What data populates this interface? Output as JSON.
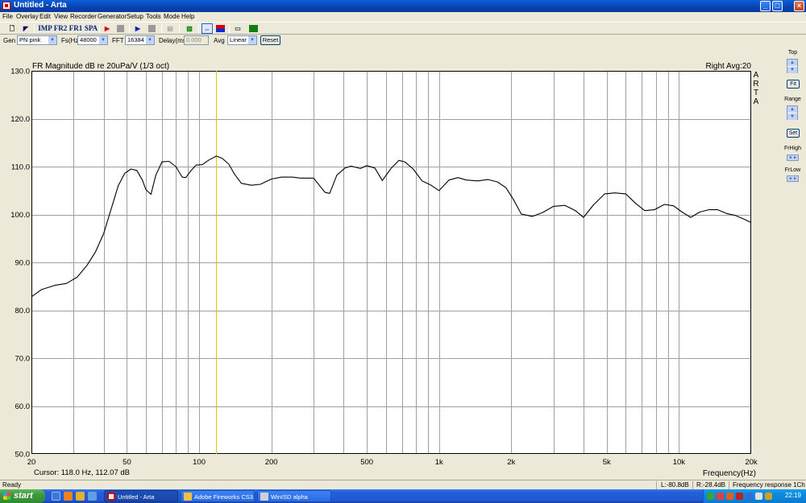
{
  "window": {
    "title": "Untitled - Arta"
  },
  "menu": [
    "File",
    "Overlay",
    "Edit",
    "View",
    "Recorder",
    "Generator",
    "Setup",
    "Tools",
    "Mode",
    "Help"
  ],
  "toolbar": {
    "imp": "IMP",
    "fr2": "FR2",
    "fr1": "FR1",
    "spa": "SPA"
  },
  "controls": {
    "gen_label": "Gen",
    "gen_value": "PN pink",
    "fs_label": "Fs(Hz)",
    "fs_value": "48000",
    "fft_label": "FFT",
    "fft_value": "16384",
    "delay_label": "Delay(ms)",
    "delay_value": "0.000",
    "avg_label": "Avg",
    "avg_value": "Linear",
    "reset_label": "Reset"
  },
  "right_panel": {
    "top_label": "Top",
    "fit_label": "Fit",
    "range_label": "Range",
    "set_label": "Set",
    "frhigh_label": "FrHigh",
    "frlow_label": "FrLow"
  },
  "status": {
    "left": "Ready",
    "l_value": "L:-80.8dB",
    "r_value": "R:-28.4dB",
    "mode": "Frequency response 1Ch"
  },
  "taskbar": {
    "start": "start",
    "tasks": [
      "Untitled - Arta",
      "Adobe Fireworks CS3...",
      "WinISD alpha"
    ],
    "clock": "22:19"
  },
  "colors": {
    "cursor": "#d8c800",
    "curve": "#000000",
    "grid": "#a0a0a0",
    "plot_bg": "#ffffff"
  },
  "chart_data": {
    "type": "line",
    "title": "FR Magnitude dB re 20uPa/V (1/3 oct)",
    "channel_info": "Right  Avg:20",
    "watermark": "A R T A",
    "xlabel": "Frequency(Hz)",
    "ylabel": "",
    "x_scale": "log",
    "xlim": [
      20,
      20000
    ],
    "ylim": [
      50,
      130
    ],
    "grid": true,
    "y_ticks": [
      "130.0",
      "120.0",
      "110.0",
      "100.0",
      "90.0",
      "80.0",
      "70.0",
      "60.0",
      "50.0"
    ],
    "x_tick_values": [
      20,
      50,
      100,
      200,
      500,
      1000,
      2000,
      5000,
      10000,
      20000
    ],
    "x_tick_labels": [
      "20",
      "50",
      "100",
      "200",
      "500",
      "1k",
      "2k",
      "5k",
      "10k",
      "20k"
    ],
    "cursor": {
      "frequency_hz": 118.0,
      "value_db": 112.07,
      "readout": "Cursor:    118.0 Hz, 112.07 dB"
    },
    "series": [
      {
        "x": [
          20,
          22,
          25,
          28,
          31,
          34,
          37,
          40,
          43,
          46,
          49,
          52,
          55,
          58,
          60,
          63,
          66,
          70,
          75,
          80,
          85,
          88,
          92,
          97,
          103,
          110,
          118,
          125,
          133,
          140,
          150,
          165,
          180,
          200,
          220,
          245,
          265,
          300,
          335,
          350,
          375,
          405,
          430,
          470,
          500,
          540,
          580,
          630,
          680,
          720,
          780,
          850,
          920,
          1000,
          1100,
          1200,
          1300,
          1450,
          1600,
          1750,
          1900,
          2050,
          2200,
          2450,
          2700,
          3000,
          3350,
          3700,
          4000,
          4400,
          4900,
          5400,
          6000,
          6600,
          7200,
          7900,
          8700,
          9500,
          10300,
          11200,
          12200,
          13300,
          14500,
          15800,
          17200,
          18700,
          20000
        ],
        "y": [
          82.8,
          84.3,
          85.2,
          85.6,
          86.9,
          89.3,
          92.2,
          96.0,
          101.2,
          106.0,
          108.6,
          109.5,
          109.2,
          107.2,
          105.2,
          104.2,
          108.2,
          111.0,
          111.1,
          110.0,
          107.8,
          107.7,
          109.0,
          110.3,
          110.4,
          111.4,
          112.2,
          111.7,
          110.5,
          108.5,
          106.5,
          106.1,
          106.3,
          107.4,
          107.8,
          107.8,
          107.6,
          107.6,
          104.6,
          104.4,
          108.2,
          109.7,
          110.1,
          109.6,
          110.2,
          109.7,
          107.1,
          109.6,
          111.3,
          111.0,
          109.5,
          107.0,
          106.2,
          105.0,
          107.2,
          107.7,
          107.2,
          107.0,
          107.3,
          106.8,
          105.6,
          103.0,
          100.1,
          99.6,
          100.4,
          101.7,
          101.9,
          100.8,
          99.4,
          102.0,
          104.3,
          104.5,
          104.3,
          102.3,
          100.8,
          101.0,
          102.1,
          101.8,
          100.5,
          99.4,
          100.5,
          101.0,
          101.0,
          100.2,
          99.8,
          99.0,
          98.3
        ]
      }
    ]
  }
}
